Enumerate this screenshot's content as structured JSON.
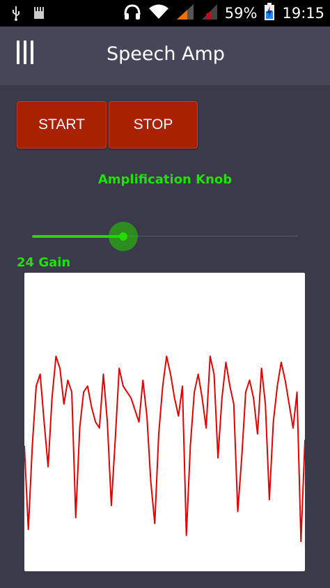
{
  "status_bar": {
    "battery_percent": "59%",
    "time": "19:15",
    "icons": [
      "usb-icon",
      "sd-card-icon",
      "headphones-icon",
      "wifi-icon",
      "signal-icon",
      "signal-no-data-icon",
      "battery-charging-icon"
    ]
  },
  "app_bar": {
    "title": "Speech Amp",
    "menu_icon": "menu-icon"
  },
  "controls": {
    "start_label": "START",
    "stop_label": "STOP"
  },
  "knob": {
    "title": "Amplification Knob",
    "value": 24,
    "max": 70,
    "gain_label": "24 Gain"
  },
  "colors": {
    "button_bg": "#a82100",
    "accent_green": "#22e000",
    "waveform": "#e00000",
    "background": "#3b3a4a",
    "app_bar": "#464658"
  },
  "waveform": {
    "samples": [
      0.42,
      0.14,
      0.42,
      0.62,
      0.66,
      0.5,
      0.35,
      0.58,
      0.72,
      0.68,
      0.56,
      0.64,
      0.6,
      0.18,
      0.48,
      0.6,
      0.62,
      0.55,
      0.5,
      0.48,
      0.66,
      0.5,
      0.22,
      0.44,
      0.68,
      0.62,
      0.6,
      0.58,
      0.54,
      0.5,
      0.64,
      0.52,
      0.3,
      0.16,
      0.46,
      0.62,
      0.72,
      0.66,
      0.58,
      0.52,
      0.62,
      0.12,
      0.42,
      0.6,
      0.66,
      0.58,
      0.48,
      0.72,
      0.66,
      0.38,
      0.58,
      0.7,
      0.62,
      0.56,
      0.2,
      0.38,
      0.6,
      0.64,
      0.58,
      0.46,
      0.68,
      0.56,
      0.24,
      0.5,
      0.62,
      0.7,
      0.64,
      0.56,
      0.48,
      0.6,
      0.1,
      0.44
    ]
  }
}
